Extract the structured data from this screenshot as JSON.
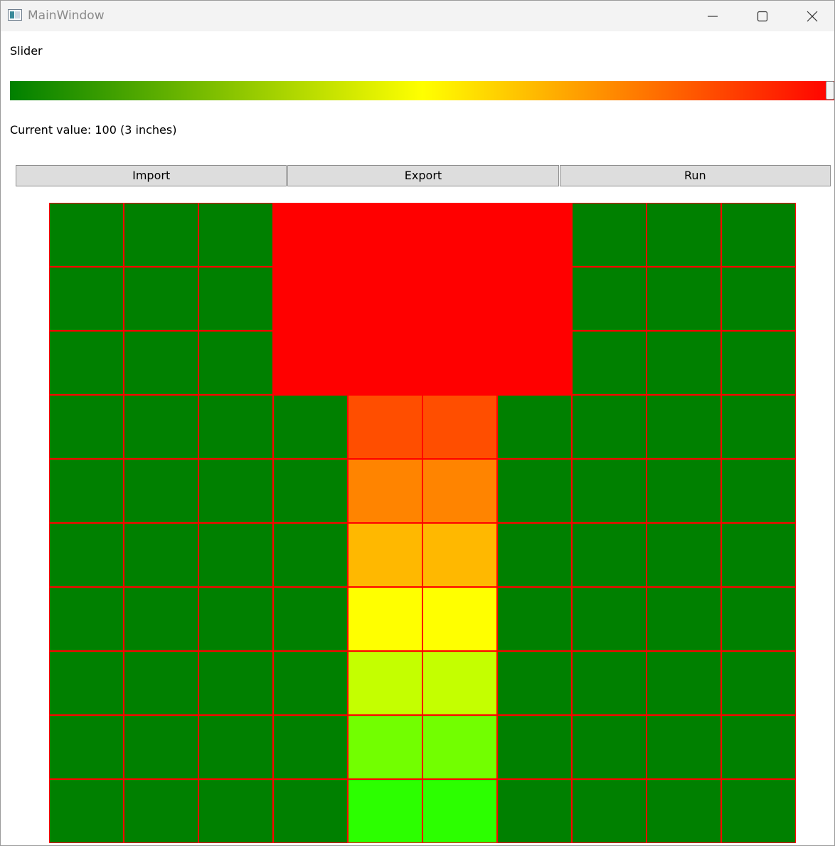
{
  "window": {
    "title": "MainWindow",
    "icon": "app-window-icon",
    "controls": [
      "minimize-icon",
      "maximize-icon",
      "close-icon"
    ]
  },
  "slider": {
    "label": "Slider",
    "value": 100,
    "min": 0,
    "max": 100,
    "gradient_colors": [
      "#008000",
      "#ffff00",
      "#ff0000"
    ],
    "current_value_text": "Current value: 100 (3 inches)"
  },
  "toolbar": {
    "import_label": "Import",
    "export_label": "Export",
    "run_label": "Run"
  },
  "grid": {
    "rows": 10,
    "cols": 10,
    "cell_border_color": "#ff0000",
    "cells": [
      [
        "#008000",
        "#008000",
        "#008000",
        "#ff0000",
        "#ff0000",
        "#ff0000",
        "#ff0000",
        "#008000",
        "#008000",
        "#008000"
      ],
      [
        "#008000",
        "#008000",
        "#008000",
        "#ff0000",
        "#ff0000",
        "#ff0000",
        "#ff0000",
        "#008000",
        "#008000",
        "#008000"
      ],
      [
        "#008000",
        "#008000",
        "#008000",
        "#ff0000",
        "#ff0000",
        "#ff0000",
        "#ff0000",
        "#008000",
        "#008000",
        "#008000"
      ],
      [
        "#008000",
        "#008000",
        "#008000",
        "#008000",
        "#ff4e00",
        "#ff4e00",
        "#008000",
        "#008000",
        "#008000",
        "#008000"
      ],
      [
        "#008000",
        "#008000",
        "#008000",
        "#008000",
        "#ff8400",
        "#ff8400",
        "#008000",
        "#008000",
        "#008000",
        "#008000"
      ],
      [
        "#008000",
        "#008000",
        "#008000",
        "#008000",
        "#ffb800",
        "#ffb800",
        "#008000",
        "#008000",
        "#008000",
        "#008000"
      ],
      [
        "#008000",
        "#008000",
        "#008000",
        "#008000",
        "#ffff00",
        "#ffff00",
        "#008000",
        "#008000",
        "#008000",
        "#008000"
      ],
      [
        "#008000",
        "#008000",
        "#008000",
        "#008000",
        "#c4ff00",
        "#c4ff00",
        "#008000",
        "#008000",
        "#008000",
        "#008000"
      ],
      [
        "#008000",
        "#008000",
        "#008000",
        "#008000",
        "#72ff00",
        "#72ff00",
        "#008000",
        "#008000",
        "#008000",
        "#008000"
      ],
      [
        "#008000",
        "#008000",
        "#008000",
        "#008000",
        "#2cff00",
        "#2cff00",
        "#008000",
        "#008000",
        "#008000",
        "#008000"
      ]
    ]
  }
}
